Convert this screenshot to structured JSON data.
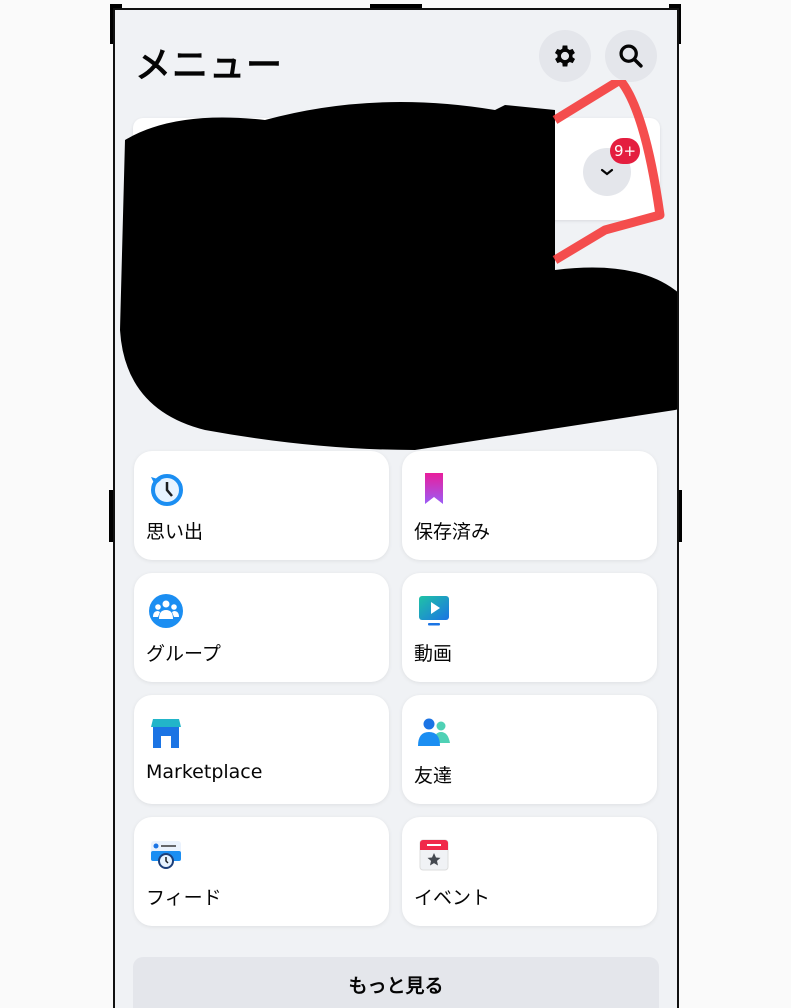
{
  "header": {
    "title": "メニュー",
    "settings_icon": "gear-icon",
    "search_icon": "search-icon"
  },
  "profile": {
    "expand_icon": "chevron-down-icon",
    "badge": "9+",
    "badge_color": "#e41e3f"
  },
  "shortcuts": [
    {
      "label": "思い出",
      "icon": "memories-clock-icon"
    },
    {
      "label": "保存済み",
      "icon": "bookmark-icon"
    },
    {
      "label": "グループ",
      "icon": "groups-icon"
    },
    {
      "label": "動画",
      "icon": "video-icon"
    },
    {
      "label": "Marketplace",
      "icon": "marketplace-store-icon"
    },
    {
      "label": "友達",
      "icon": "friends-icon"
    },
    {
      "label": "フィード",
      "icon": "feed-icon"
    },
    {
      "label": "イベント",
      "icon": "calendar-star-icon"
    }
  ],
  "see_more": "もっと見る"
}
